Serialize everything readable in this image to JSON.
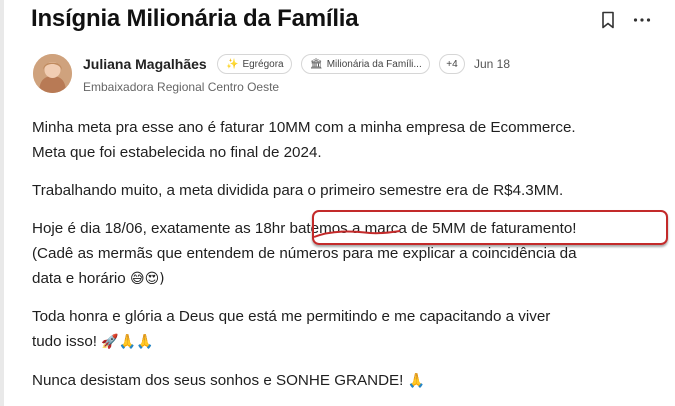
{
  "post": {
    "title": "Insígnia Milionária da Família",
    "actions": {
      "bookmark_icon": "bookmark-icon",
      "more_icon": "more-horizontal-icon"
    },
    "author": {
      "name": "Juliana Magalhães",
      "subtitle": "Embaixadora Regional Centro Oeste",
      "badges": [
        {
          "icon": "✨",
          "label": "Egrégora"
        },
        {
          "icon": "🏛",
          "label": "Milionária da Famíli..."
        }
      ],
      "more_badges": "+4",
      "date": "Jun 18"
    },
    "paragraphs": {
      "p1_line1": "Minha meta pra esse ano é faturar 10MM com a minha empresa de Ecommerce.",
      "p1_line2": "Meta que foi estabelecida no final de 2024.",
      "p2": "Trabalhando muito, a meta dividida para o primeiro semestre era de R$4.3MM.",
      "p3_line1_a": "Hoje é dia 18/06, exatamente as 18hr ",
      "p3_line1_b": "batemos a marca de 5MM de faturamento!",
      "p3_line2": "(Cadê as mermãs que entendem de números para me explicar a coincidência da",
      "p3_line3": "data e horário",
      "p3_emojis": "😅😍)",
      "p4_line1": "Toda honra e glória a Deus que está me permitindo e me capacitando a viver",
      "p4_line2": "tudo isso!",
      "p4_emojis": "🚀🙏🙏",
      "p5": "Nunca desistam dos seus sonhos e SONHE GRANDE!",
      "p5_emoji": "🙏"
    }
  },
  "colors": {
    "highlight": "#c32a2a",
    "text": "#1f1f1f"
  }
}
